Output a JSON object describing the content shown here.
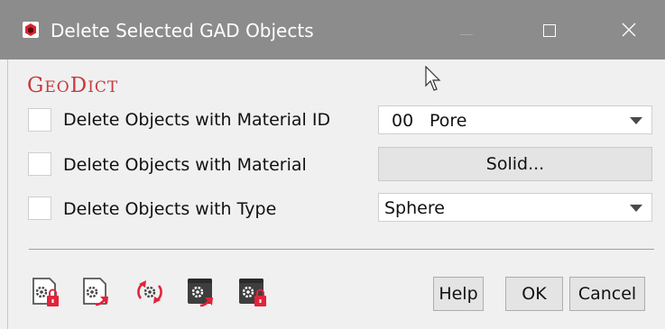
{
  "window": {
    "title": "Delete Selected GAD Objects",
    "minimize_label": "",
    "maximize_label": "",
    "close_label": ""
  },
  "logo": {
    "part1_cap": "G",
    "part1_rest": "EO",
    "part2_cap": "D",
    "part2_rest": "ICT",
    "color": "#c8393e"
  },
  "rows": [
    {
      "label": "Delete Objects with Material ID",
      "checked": false
    },
    {
      "label": "Delete Objects with Material",
      "checked": false
    },
    {
      "label": "Delete Objects with Type",
      "checked": false
    }
  ],
  "material_id_select": {
    "id": "00",
    "value": "Pore"
  },
  "material_button": {
    "label": "Solid..."
  },
  "type_select": {
    "value": "Sphere"
  },
  "toolbar_icons": [
    {
      "icon": "gad-lock-icon"
    },
    {
      "icon": "gad-export-icon"
    },
    {
      "icon": "gad-refresh-icon"
    },
    {
      "icon": "gad-dark-export-icon"
    },
    {
      "icon": "gad-dark-lock-icon"
    }
  ],
  "buttons": {
    "help": "Help",
    "ok": "OK",
    "cancel": "Cancel"
  },
  "colors": {
    "titlebar": "#8c8c8c",
    "accent_red": "#e2233a",
    "dialog_bg": "#f0f0f0"
  }
}
